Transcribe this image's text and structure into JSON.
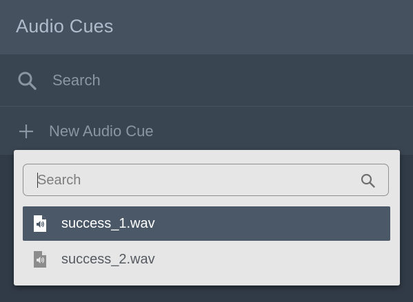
{
  "panel": {
    "title": "Audio Cues",
    "search": {
      "placeholder": "Search",
      "icon": "search-icon"
    },
    "new_cue": {
      "label": "New Audio Cue",
      "icon": "plus-icon"
    }
  },
  "dropdown": {
    "search": {
      "placeholder": "Search",
      "value": "",
      "icon": "search-icon"
    },
    "files": [
      {
        "name": "success_1.wav",
        "icon": "audio-file-icon",
        "selected": true
      },
      {
        "name": "success_2.wav",
        "icon": "audio-file-icon",
        "selected": false
      }
    ]
  },
  "colors": {
    "panel_bg": "#313b47",
    "header_bg": "#45515f",
    "row_bg": "#3a4552",
    "dropdown_bg": "#e6e6e6",
    "selected_bg": "#4b5867"
  }
}
